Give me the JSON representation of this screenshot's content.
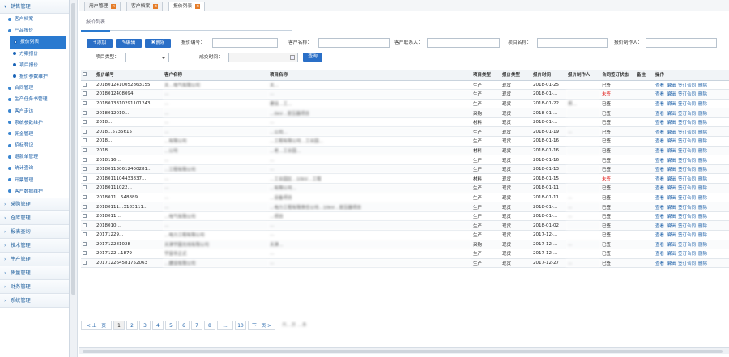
{
  "sidebar": {
    "group_sales": "销售管理",
    "items": [
      {
        "label": "客户档案",
        "level": 1
      },
      {
        "label": "产品报价",
        "level": 1
      },
      {
        "label": "报价列表",
        "level": 2,
        "active": true
      },
      {
        "label": "方案报价",
        "level": 2
      },
      {
        "label": "项目报价",
        "level": 2
      },
      {
        "label": "报价参数维护",
        "level": 2
      },
      {
        "label": "合同管理",
        "level": 1
      },
      {
        "label": "生产任务书管理",
        "level": 1
      },
      {
        "label": "客户走访",
        "level": 1
      },
      {
        "label": "系统参数维护",
        "level": 1
      },
      {
        "label": "佣金管理",
        "level": 1
      },
      {
        "label": "招标登记",
        "level": 1
      },
      {
        "label": "退款单管理",
        "level": 1
      },
      {
        "label": "统计查询",
        "level": 1
      },
      {
        "label": "开票管理",
        "level": 1
      },
      {
        "label": "客户数据维护",
        "level": 1
      }
    ],
    "groups": [
      "采购管理",
      "仓库管理",
      "报表查询",
      "技术管理",
      "生产管理",
      "质量管理",
      "财务管理",
      "系统管理"
    ]
  },
  "tabs": [
    "用户管理",
    "客户档案",
    "报价列表"
  ],
  "page": {
    "title": "报价列表"
  },
  "toolbar": {
    "add": "+添加",
    "edit": "✎编辑",
    "delete": "✖删除"
  },
  "filters": {
    "quote_no": "报价编号：",
    "customer_name": "客户名称：",
    "contact": "客户联系人：",
    "project_name": "项目名称：",
    "quote_maker": "报价制作人：",
    "project_type": "项目类型：",
    "deal_time": "成交时间：",
    "search_btn": "查询"
  },
  "table": {
    "headers": [
      "",
      "报价编号",
      "客户名称",
      "项目名称",
      "项目类型",
      "报价类型",
      "报价时间",
      "报价制作人",
      "合同签订状态",
      "备注",
      "操作"
    ],
    "rows": [
      [
        "2018012410052863155",
        "天…电气有限公司",
        "天…",
        "生产",
        "现货",
        "2018-01-25",
        "",
        "已签"
      ],
      [
        "2018012408094",
        "…",
        "…",
        "生产",
        "现货",
        "2018-01-…",
        "",
        "未签"
      ],
      [
        "2018013310291101243",
        "…",
        "建设…工…",
        "生产",
        "现货",
        "2018-01-22",
        "郑…",
        "已签"
      ],
      [
        "2018012010…",
        "…",
        "…0kV…变压器项目",
        "采购",
        "现货",
        "2018-01-…",
        "",
        "已签"
      ],
      [
        "2018…",
        "…",
        "…",
        "材料",
        "现货",
        "2018-01-…",
        "",
        "已签"
      ],
      [
        "2018…5735615",
        "…",
        "…公司…",
        "生产",
        "现货",
        "2018-01-19",
        "…",
        "已签"
      ],
      [
        "2018…",
        "…有限公司",
        "…工程有限公司…工业园…",
        "生产",
        "现货",
        "2018-01-16",
        "",
        "已签"
      ],
      [
        "2018…",
        "…公司",
        "…老…工业园…",
        "材料",
        "现货",
        "2018-01-16",
        "",
        "已签"
      ],
      [
        "2018116…",
        "…",
        "…",
        "生产",
        "现货",
        "2018-01-16",
        "",
        "已签"
      ],
      [
        "201801130612400281…",
        "…工程有限公司",
        "…",
        "生产",
        "现货",
        "2018-01-13",
        "",
        "已签"
      ],
      [
        "2018011104433837…",
        "…",
        "…工业园区…10kV…工程",
        "材料",
        "现货",
        "2018-01-15",
        "",
        "未签"
      ],
      [
        "20180111022…",
        "…",
        "…有限公司…",
        "生产",
        "现货",
        "2018-01-11",
        "",
        "已签"
      ],
      [
        "2018011…548889",
        "…",
        "…设备项目",
        "生产",
        "现货",
        "2018-01-11",
        "…",
        "已签"
      ],
      [
        "20180111…3183111…",
        "…",
        "…电力工程有限责任公司…10kV…变压器项目",
        "生产",
        "现货",
        "2018-01-…",
        "…",
        "已签"
      ],
      [
        "2018011…",
        "…电气有限公司",
        "…项目",
        "生产",
        "现货",
        "2018-01-…",
        "…",
        "已签"
      ],
      [
        "2018010…",
        "…",
        "…",
        "生产",
        "现货",
        "2018-01-02",
        "",
        "已签"
      ],
      [
        "20171229…",
        "…电力工程有限公司",
        "…",
        "生产",
        "现货",
        "2017-12-…",
        "",
        "已签"
      ],
      [
        "201712281028",
        "天津宇圆无线有限公司",
        "天津…",
        "采购",
        "现货",
        "2017-12-…",
        "…",
        "已签"
      ],
      [
        "2017122…1879",
        "宇宙非正式",
        "…",
        "生产",
        "现货",
        "2017-12-…",
        "",
        "已签"
      ],
      [
        "201712264581752063",
        "…建设有限公司",
        "…",
        "生产",
        "现货",
        "2017-12-27",
        "…",
        "已签"
      ]
    ],
    "ops": [
      "查看",
      "编辑",
      "签订合同",
      "删除"
    ]
  },
  "pager": {
    "prev": "< 上一页",
    "pages": [
      "1",
      "2",
      "3",
      "4",
      "5",
      "6",
      "7",
      "8",
      "...",
      "10"
    ],
    "next": "下一页 >",
    "total": "共…页 …条"
  },
  "colors": {
    "accent": "#2a6fc7",
    "link": "#1b5fa8",
    "red": "#e0201e"
  }
}
